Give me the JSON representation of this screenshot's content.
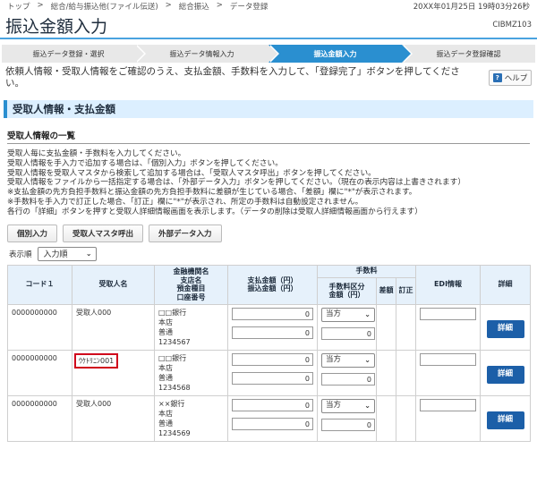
{
  "breadcrumb": [
    "トップ",
    "総合/給与振込他(ファイル伝送)",
    "総合振込",
    "データ登録"
  ],
  "breadcrumb_sep": ">",
  "datetime": "20XX年01月25日 19時03分26秒",
  "title": "振込金額入力",
  "screen_id": "CIBMZ103",
  "steps": [
    {
      "label": "振込データ登録・選択",
      "active": false
    },
    {
      "label": "振込データ情報入力",
      "active": false
    },
    {
      "label": "振込金額入力",
      "active": true
    },
    {
      "label": "振込データ登録確認",
      "active": false
    }
  ],
  "intro_text": "依頼人情報・受取人情報をご確認のうえ、支払金額、手数料を入力して、「登録完了」ボタンを押してください。",
  "help": {
    "label": "ヘルプ",
    "icon": "?"
  },
  "section_title": "受取人情報・支払金額",
  "subsection_title": "受取人情報の一覧",
  "notes": [
    "受取人毎に支払金額・手数料を入力してください。",
    "受取人情報を手入力で追加する場合は、「個別入力」ボタンを押してください。",
    "受取人情報を受取人マスタから検索して追加する場合は、「受取人マスタ呼出」ボタンを押してください。",
    "受取人情報をファイルから一括指定する場合は、「外部データ入力」ボタンを押してください。（現在の表示内容は上書きされます）",
    "※支払金額の先方負担手数料と振込金額の先方負担手数料に差額が生じている場合、「差額」欄に\"*\"が表示されます。",
    "※手数料を手入力で訂正した場合、「訂正」欄に\"*\"が表示され、所定の手数料は自動設定されません。",
    "各行の「詳細」ボタンを押すと受取人詳細情報画面を表示します。（データの削除は受取人詳細情報画面から行えます）"
  ],
  "buttons": {
    "individual": "個別入力",
    "master": "受取人マスタ呼出",
    "external": "外部データ入力"
  },
  "sort": {
    "label": "表示順",
    "value": "入力順"
  },
  "table": {
    "headers": {
      "code": "コード１",
      "payee": "受取人名",
      "bank": [
        "金融機関名",
        "支店名",
        "預金種目",
        "口座番号"
      ],
      "amount": [
        "支払金額（円）",
        "振込金額（円）"
      ],
      "fee_group": "手数料",
      "fee_type": [
        "手数料区分",
        "金額（円）"
      ],
      "diff": "差額",
      "corr": "訂正",
      "edi": "EDI情報",
      "detail": "詳細"
    },
    "rows": [
      {
        "code": "0000000000",
        "payee": "受取人000",
        "bank": "□□銀行",
        "branch": "本店",
        "type": "普通",
        "account": "1234567",
        "pay_amount": "0",
        "transfer_amount": "0",
        "fee_type": "当方",
        "fee_amount": "0",
        "detail": "詳細",
        "highlight": false
      },
      {
        "code": "0000000000",
        "payee": "ｳｹﾄﾘﾆﾝ001",
        "bank": "□□銀行",
        "branch": "本店",
        "type": "普通",
        "account": "1234568",
        "pay_amount": "0",
        "transfer_amount": "0",
        "fee_type": "当方",
        "fee_amount": "0",
        "detail": "詳細",
        "highlight": true
      },
      {
        "code": "0000000000",
        "payee": "受取人000",
        "bank": "××銀行",
        "branch": "本店",
        "type": "普通",
        "account": "1234569",
        "pay_amount": "0",
        "transfer_amount": "0",
        "fee_type": "当方",
        "fee_amount": "0",
        "detail": "詳細",
        "highlight": false
      }
    ]
  }
}
